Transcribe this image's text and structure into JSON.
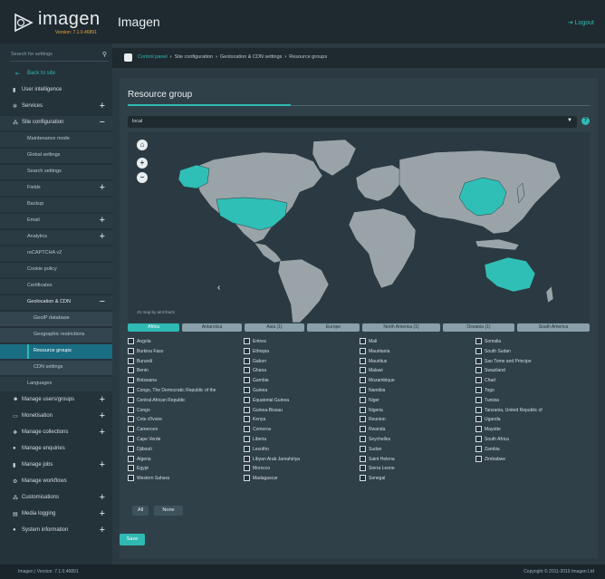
{
  "app": {
    "logo_word": "imagen",
    "version_label": "Version: 7.1.0.46891",
    "title": "Imagen",
    "logout_label": "Logout"
  },
  "sidebar": {
    "search_placeholder": "Search for settings",
    "items": [
      {
        "label": "Back to site"
      },
      {
        "label": "User intelligence"
      },
      {
        "label": "Services"
      },
      {
        "label": "Site configuration"
      },
      {
        "label": "Maintenance mode"
      },
      {
        "label": "Global settings"
      },
      {
        "label": "Search settings"
      },
      {
        "label": "Fields"
      },
      {
        "label": "Backup"
      },
      {
        "label": "Email"
      },
      {
        "label": "Analytics"
      },
      {
        "label": "reCAPTCHA v2"
      },
      {
        "label": "Cookie policy"
      },
      {
        "label": "Certificates"
      },
      {
        "label": "Geolocation & CDN"
      },
      {
        "label": "GeoIP database"
      },
      {
        "label": "Geographic restrictions"
      },
      {
        "label": "Resource groups"
      },
      {
        "label": "CDN settings"
      },
      {
        "label": "Languages"
      },
      {
        "label": "Manage users/groups"
      },
      {
        "label": "Monetisation"
      },
      {
        "label": "Manage collections"
      },
      {
        "label": "Manage enquiries"
      },
      {
        "label": "Manage jobs"
      },
      {
        "label": "Manage workflows"
      },
      {
        "label": "Customisations"
      },
      {
        "label": "Media logging"
      },
      {
        "label": "System information"
      }
    ]
  },
  "breadcrumb": [
    "Control panel",
    "Site configuration",
    "Geolocation & CDN settings",
    "Resource groups"
  ],
  "card": {
    "title": "Resource group",
    "select_value": "local",
    "help": "?",
    "map_credit": "JS map by amCharts",
    "zoom_in": "+",
    "zoom_out": "−",
    "back_arrow": "‹"
  },
  "tabs": [
    "Africa",
    "Antarctica",
    "Asia (1)",
    "Europe",
    "North America (1)",
    "Oceania (1)",
    "South America"
  ],
  "countries": [
    [
      "Angola",
      "Burkina Faso",
      "Burundi",
      "Benin",
      "Botswana",
      "Congo, The Democratic Republic of the",
      "Central African Republic",
      "Congo",
      "Cote d'Ivoire",
      "Cameroon",
      "Cape Verde",
      "Djibouti",
      "Algeria",
      "Egypt",
      "Western Sahara"
    ],
    [
      "Eritrea",
      "Ethiopia",
      "Gabon",
      "Ghana",
      "Gambia",
      "Guinea",
      "Equatorial Guinea",
      "Guinea-Bissau",
      "Kenya",
      "Comoros",
      "Liberia",
      "Lesotho",
      "Libyan Arab Jamahiriya",
      "Morocco",
      "Madagascar"
    ],
    [
      "Mali",
      "Mauritania",
      "Mauritius",
      "Malawi",
      "Mozambique",
      "Namibia",
      "Niger",
      "Nigeria",
      "Reunion",
      "Rwanda",
      "Seychelles",
      "Sudan",
      "Saint Helena",
      "Sierra Leone",
      "Senegal"
    ],
    [
      "Somalia",
      "South Sudan",
      "Sao Tome and Principe",
      "Swaziland",
      "Chad",
      "Togo",
      "Tunisia",
      "Tanzania, United Republic of",
      "Uganda",
      "Mayotte",
      "South Africa",
      "Zambia",
      "Zimbabwe"
    ]
  ],
  "buttons": {
    "all": "All",
    "none": "None",
    "save": "Save"
  },
  "footer": {
    "left": "Imagen | Version: 7.1.0.46891",
    "right": "Copyright © 2011-2019 Imagen Ltd"
  },
  "colors": {
    "accent": "#2fb9b3",
    "land": "#9aa4a8",
    "selected": "#2fbfb6"
  }
}
